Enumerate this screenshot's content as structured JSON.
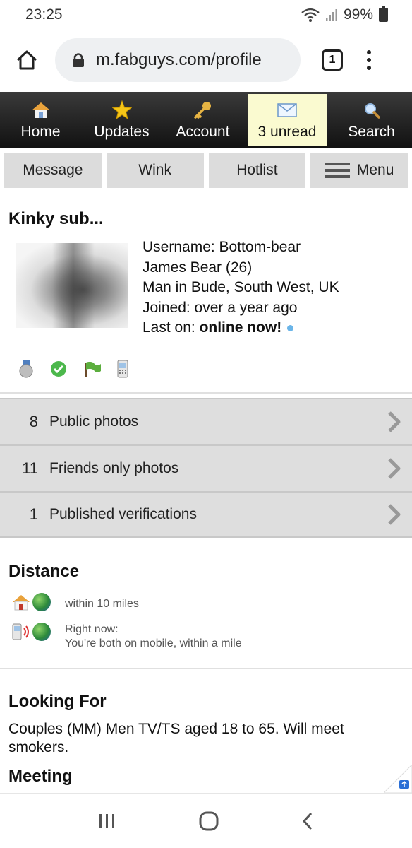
{
  "status_bar": {
    "time": "23:25",
    "battery": "99%"
  },
  "browser": {
    "url": "m.fabguys.com/profile",
    "tab_count": "1"
  },
  "site_nav": [
    {
      "label": "Home",
      "icon": "house-icon"
    },
    {
      "label": "Updates",
      "icon": "star-icon"
    },
    {
      "label": "Account",
      "icon": "key-icon"
    },
    {
      "label": "3 unread",
      "icon": "envelope-icon"
    },
    {
      "label": "Search",
      "icon": "magnifier-icon"
    }
  ],
  "actions": {
    "message": "Message",
    "wink": "Wink",
    "hotlist": "Hotlist",
    "menu": "Menu"
  },
  "profile": {
    "title": "Kinky sub...",
    "username": "Username: Bottom-bear",
    "name_age": "James Bear (26)",
    "location": "Man in Bude, South West, UK",
    "joined": "Joined: over a year ago",
    "last_on_label": "Last on: ",
    "last_on_value": "online now!"
  },
  "photo_rows": [
    {
      "count": "8",
      "label": "Public photos"
    },
    {
      "count": "11",
      "label": "Friends only photos"
    },
    {
      "count": "1",
      "label": "Published verifications"
    }
  ],
  "distance": {
    "title": "Distance",
    "home": "within 10 miles",
    "now_label": "Right now:",
    "now_text": "You're both on mobile, within a mile"
  },
  "looking_for": {
    "title": "Looking For",
    "text": "Couples (MM) Men TV/TS aged 18 to 65. Will meet smokers."
  },
  "meeting": {
    "title": "Meeting"
  }
}
